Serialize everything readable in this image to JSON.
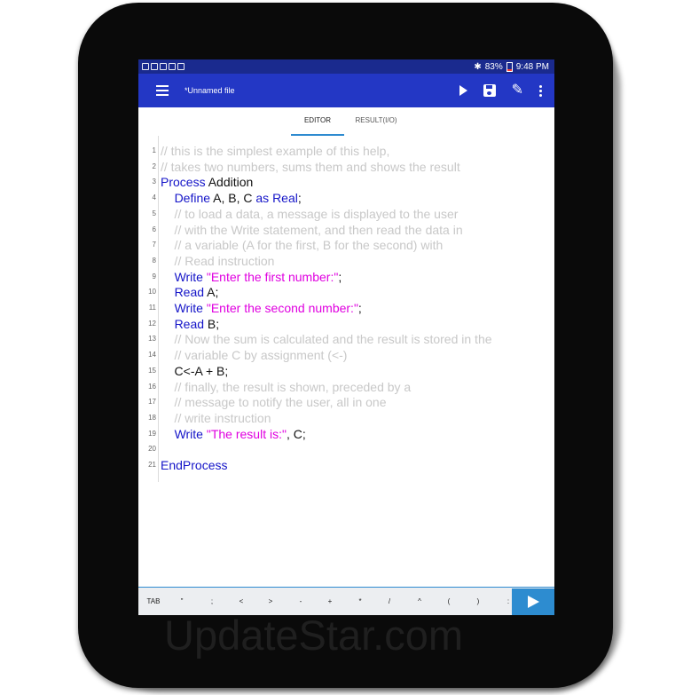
{
  "status": {
    "battery": "83%",
    "time": "9:48 PM",
    "bluetooth_icon": "bluetooth-icon"
  },
  "appbar": {
    "filename": "*Unnamed file",
    "icons": [
      "menu-icon",
      "play-icon",
      "save-icon",
      "pencil-icon",
      "more-vert-icon"
    ]
  },
  "tabs": [
    {
      "label": "EDITOR",
      "active": true
    },
    {
      "label": "RESULT(I/O)",
      "active": false
    }
  ],
  "code": [
    {
      "n": "1",
      "t": [
        {
          "c": "cm",
          "s": "// this is the simplest example of this help,"
        }
      ]
    },
    {
      "n": "2",
      "t": [
        {
          "c": "cm",
          "s": "// takes two numbers, sums them and shows the result"
        }
      ]
    },
    {
      "n": "3",
      "t": [
        {
          "c": "kw",
          "s": "Process"
        },
        {
          "c": "",
          "s": " Addition"
        }
      ]
    },
    {
      "n": "4",
      "t": [
        {
          "c": "",
          "s": "    "
        },
        {
          "c": "kw",
          "s": "Define"
        },
        {
          "c": "",
          "s": " A, B, C "
        },
        {
          "c": "kw",
          "s": "as Real"
        },
        {
          "c": "",
          "s": ";"
        }
      ]
    },
    {
      "n": "5",
      "t": [
        {
          "c": "cm",
          "s": "    // to load a data, a message is displayed to the user"
        }
      ]
    },
    {
      "n": "6",
      "t": [
        {
          "c": "cm",
          "s": "    // with the Write statement, and then read the data in"
        }
      ]
    },
    {
      "n": "7",
      "t": [
        {
          "c": "cm",
          "s": "    // a variable (A for the first, B for the second) with"
        }
      ]
    },
    {
      "n": "8",
      "t": [
        {
          "c": "cm",
          "s": "    // Read instruction"
        }
      ]
    },
    {
      "n": "9",
      "t": [
        {
          "c": "",
          "s": "    "
        },
        {
          "c": "kw",
          "s": "Write"
        },
        {
          "c": "",
          "s": " "
        },
        {
          "c": "str",
          "s": "\"Enter the first number:\""
        },
        {
          "c": "",
          "s": ";"
        }
      ]
    },
    {
      "n": "10",
      "t": [
        {
          "c": "",
          "s": "    "
        },
        {
          "c": "kw",
          "s": "Read"
        },
        {
          "c": "",
          "s": " A;"
        }
      ]
    },
    {
      "n": "11",
      "t": [
        {
          "c": "",
          "s": "    "
        },
        {
          "c": "kw",
          "s": "Write"
        },
        {
          "c": "",
          "s": " "
        },
        {
          "c": "str",
          "s": "\"Enter the second number:\""
        },
        {
          "c": "",
          "s": ";"
        }
      ]
    },
    {
      "n": "12",
      "t": [
        {
          "c": "",
          "s": "    "
        },
        {
          "c": "kw",
          "s": "Read"
        },
        {
          "c": "",
          "s": " B;"
        }
      ]
    },
    {
      "n": "13",
      "t": [
        {
          "c": "cm",
          "s": "    // Now the sum is calculated and the result is stored in the"
        }
      ]
    },
    {
      "n": "14",
      "t": [
        {
          "c": "cm",
          "s": "    // variable C by assignment (<-)"
        }
      ]
    },
    {
      "n": "15",
      "t": [
        {
          "c": "",
          "s": "    C<-A + B;"
        }
      ]
    },
    {
      "n": "16",
      "t": [
        {
          "c": "cm",
          "s": "    // finally, the result is shown, preceded by a"
        }
      ]
    },
    {
      "n": "17",
      "t": [
        {
          "c": "cm",
          "s": "    // message to notify the user, all in one"
        }
      ]
    },
    {
      "n": "18",
      "t": [
        {
          "c": "cm",
          "s": "    // write instruction"
        }
      ]
    },
    {
      "n": "19",
      "t": [
        {
          "c": "",
          "s": "    "
        },
        {
          "c": "kw",
          "s": "Write"
        },
        {
          "c": "",
          "s": " "
        },
        {
          "c": "str",
          "s": "\"The result is:\""
        },
        {
          "c": "",
          "s": ", C;"
        }
      ]
    },
    {
      "n": "20",
      "t": []
    },
    {
      "n": "21",
      "t": [
        {
          "c": "kw",
          "s": "EndProcess"
        }
      ]
    }
  ],
  "keys": [
    "TAB",
    "\"",
    ";",
    "<",
    ">",
    "-",
    "+",
    "*",
    "/",
    "^",
    "(",
    ")",
    ":"
  ],
  "run_icon": "run-play-icon",
  "watermark": "UpdateStar.com",
  "colors": {
    "statusbar": "#1a2a8e",
    "appbar": "#2337c5",
    "keyword": "#1414c8",
    "string": "#e000e0",
    "comment": "#c8c8c8",
    "accent": "#2d8cd0"
  }
}
